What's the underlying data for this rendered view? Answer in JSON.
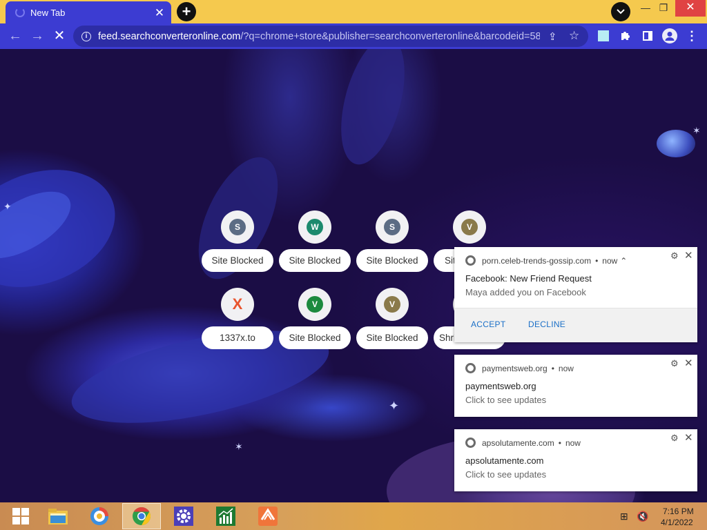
{
  "browser": {
    "tab_title": "New Tab",
    "url_host": "feed.searchconverteronline.com",
    "url_rest": "/?q=chrome+store&publisher=searchconverteronline&barcodeid=58..."
  },
  "tiles": [
    {
      "letter": "S",
      "label": "Site Blocked",
      "color": "#5b6c84"
    },
    {
      "letter": "W",
      "label": "Site Blocked",
      "color": "#1c8a6d"
    },
    {
      "letter": "S",
      "label": "Site Blocked",
      "color": "#5b6c84"
    },
    {
      "letter": "V",
      "label": "Sit",
      "color": "#8a7a4a"
    },
    {
      "letter": "X",
      "label": "1337x.to",
      "color": "#e8542d"
    },
    {
      "letter": "V",
      "label": "Site Blocked",
      "color": "#1c8a3e"
    },
    {
      "letter": "V",
      "label": "Site Blocked",
      "color": "#8a7a4a"
    },
    {
      "letter": "",
      "label": "Shri",
      "color": "#5b6c84"
    }
  ],
  "notifications": [
    {
      "site": "porn.celeb-trends-gossip.com",
      "time": "now",
      "title": "Facebook: New Friend Request",
      "body": "Maya added you on Facebook",
      "accept": "ACCEPT",
      "decline": "DECLINE"
    },
    {
      "site": "paymentsweb.org",
      "time": "now",
      "title": "paymentsweb.org",
      "body": "Click to see updates"
    },
    {
      "site": "apsolutamente.com",
      "time": "now",
      "title": "apsolutamente.com",
      "body": "Click to see updates"
    }
  ],
  "taskbar": {
    "time": "7:16 PM",
    "date": "4/1/2022"
  },
  "icons": [
    "windows-logo-icon",
    "file-explorer-icon",
    "browser-icon",
    "chrome-icon",
    "settings-app-icon",
    "stock-chart-app-icon",
    "sublime-app-icon",
    "network-icon",
    "volume-muted-icon"
  ]
}
